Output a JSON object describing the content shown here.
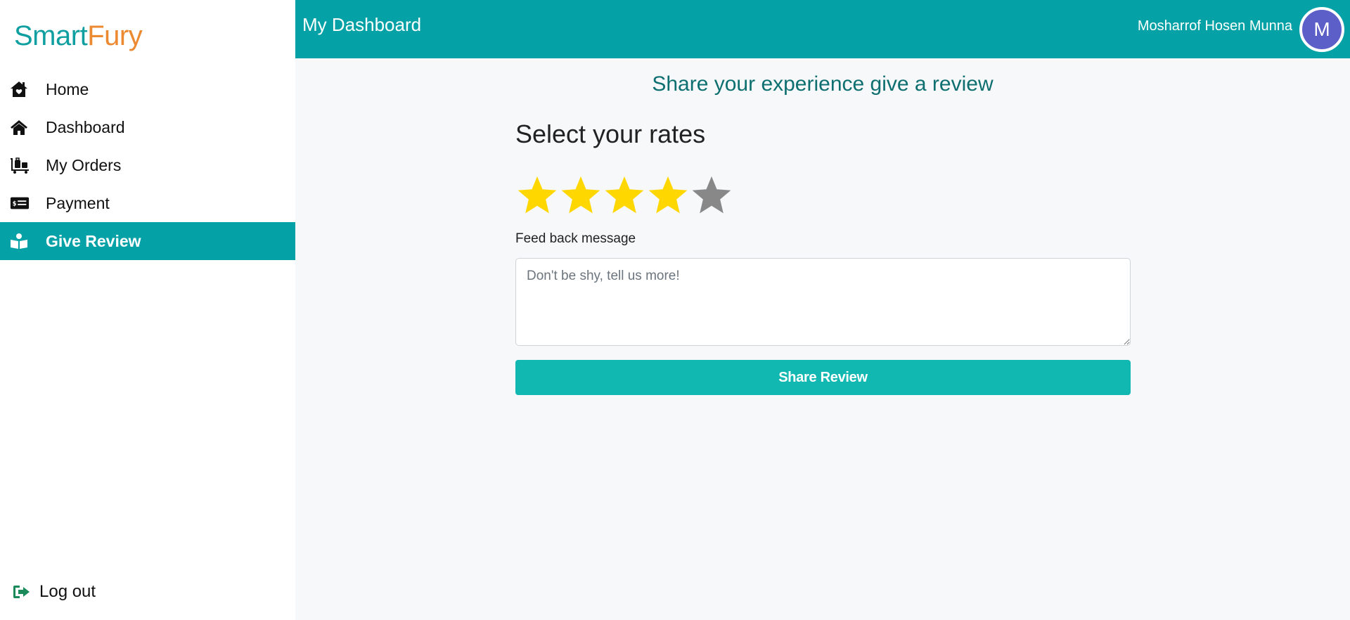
{
  "brand": {
    "part1": "Smart",
    "part2": "Fury"
  },
  "sidebar": {
    "items": [
      {
        "label": "Home",
        "icon": "home-heart-icon"
      },
      {
        "label": "Dashboard",
        "icon": "house-icon"
      },
      {
        "label": "My Orders",
        "icon": "luggage-cart-icon"
      },
      {
        "label": "Payment",
        "icon": "money-check-icon"
      },
      {
        "label": "Give Review",
        "icon": "book-reader-icon",
        "active": true
      }
    ],
    "logout": {
      "label": "Log out",
      "icon": "sign-out-icon"
    }
  },
  "header": {
    "title": "My Dashboard",
    "user_name": "Mosharrof Hosen Munna",
    "avatar_initial": "M"
  },
  "main": {
    "heading": "Share your experience give a review",
    "rates_title": "Select your rates",
    "rating": {
      "value": 4,
      "max": 5
    },
    "feedback_label": "Feed back message",
    "feedback_placeholder": "Don't be shy, tell us more!",
    "feedback_value": "",
    "submit_label": "Share Review"
  },
  "colors": {
    "primary": "#04a2a6",
    "button": "#11b8b2",
    "brand_teal": "#0f9fa0",
    "brand_orange": "#ec8a32",
    "star_filled": "#ffd700",
    "star_empty": "#888888",
    "heading": "#0e6f70",
    "avatar_bg": "#5b5fc7",
    "logout_icon": "#1a8a5a"
  }
}
